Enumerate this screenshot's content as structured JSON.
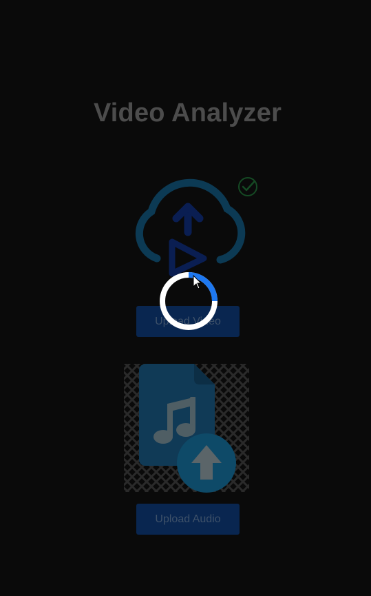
{
  "header": {
    "title": "Video Analyzer"
  },
  "video_section": {
    "icon": "cloud-upload-video-icon",
    "status_icon": "check-circle-icon",
    "button_label": "Upload Video"
  },
  "audio_section": {
    "icon": "audio-file-upload-icon",
    "button_label": "Upload Audio"
  },
  "overlay": {
    "spinner_icon": "loading-spinner-icon",
    "cursor_icon": "mouse-pointer-icon"
  },
  "colors": {
    "background": "#0a0a0a",
    "title": "#4c4c4c",
    "button_bg": "#092650",
    "button_text": "#3e5169",
    "cloud_stroke": "#0c3a54",
    "arrow_fill": "#0a1e52",
    "check_green": "#154a24",
    "spinner_white": "#ffffff",
    "spinner_blue": "#1e78f0"
  }
}
